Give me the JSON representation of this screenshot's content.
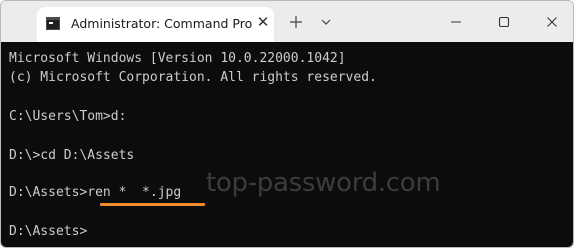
{
  "window": {
    "tab_title": "Administrator: Command Pro",
    "tab_close": "✕",
    "new_tab": "+",
    "dropdown": "⌄"
  },
  "terminal": {
    "lines": [
      "Microsoft Windows [Version 10.0.22000.1042]",
      "(c) Microsoft Corporation. All rights reserved.",
      "",
      "C:\\Users\\Tom>d:",
      "",
      "D:\\>cd D:\\Assets",
      "",
      "D:\\Assets>ren *  *.jpg",
      "",
      "D:\\Assets>"
    ]
  },
  "watermark": "top-password.com",
  "colors": {
    "terminal_bg": "#0c0c0c",
    "terminal_text": "#cccccc",
    "underline": "#f08c2c",
    "titlebar": "#ececec"
  }
}
